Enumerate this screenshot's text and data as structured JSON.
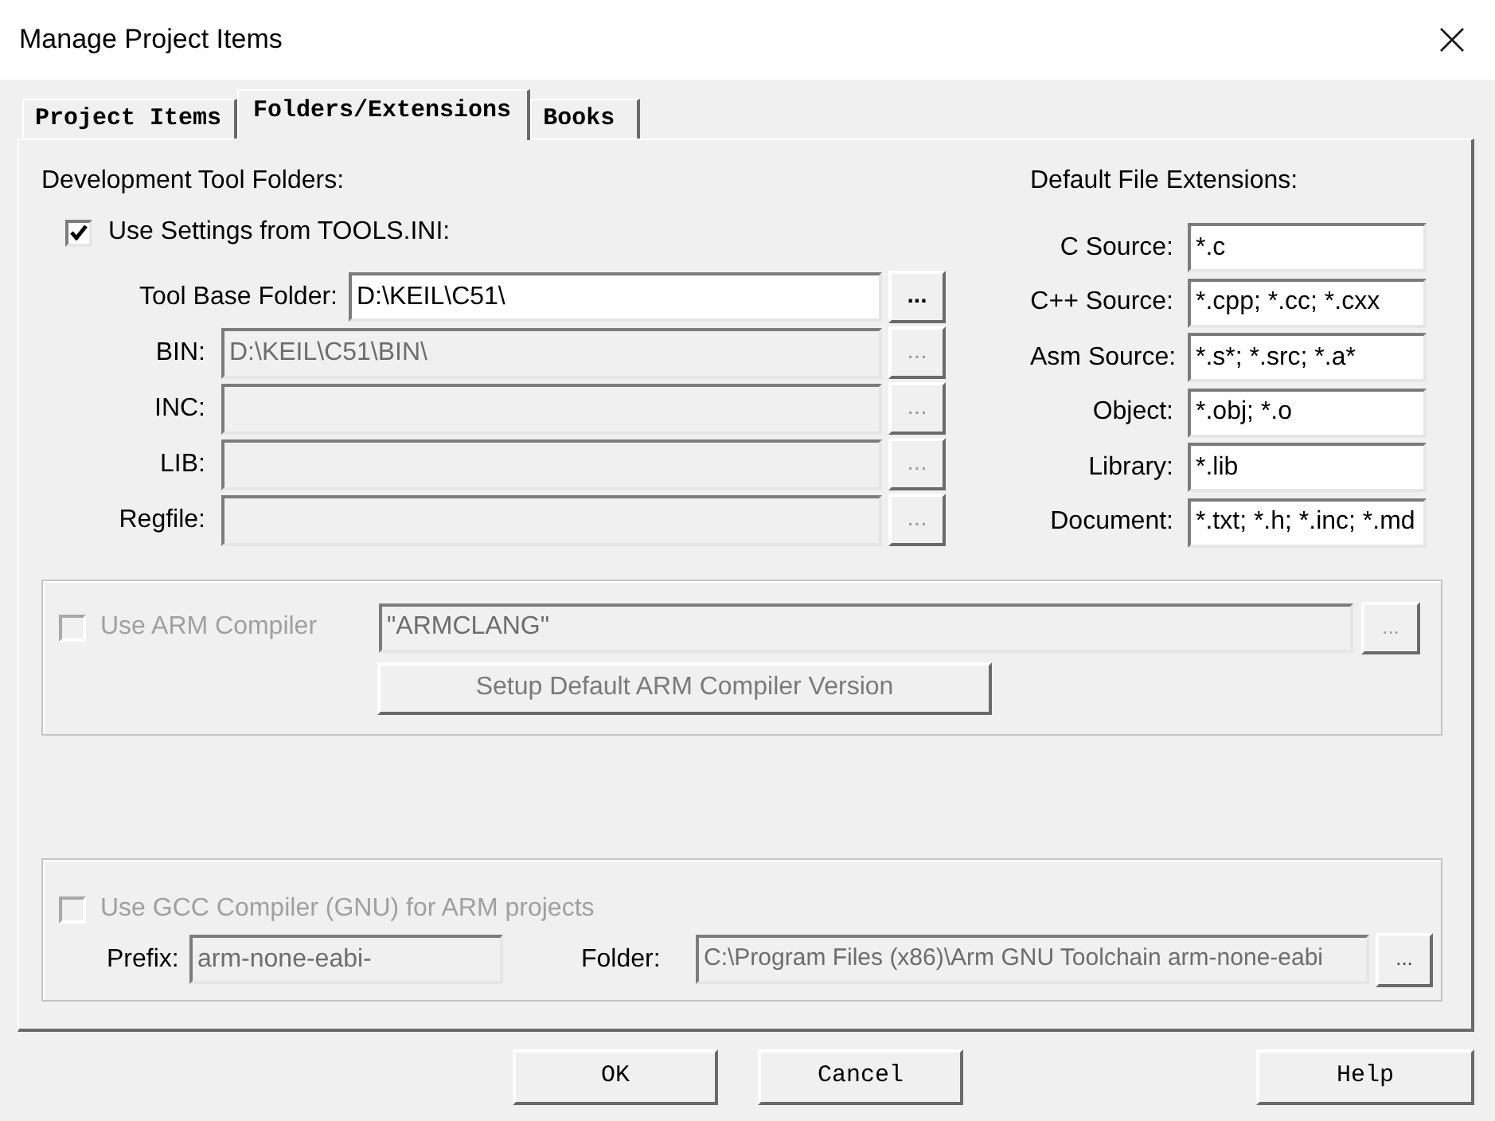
{
  "window": {
    "title": "Manage Project Items"
  },
  "tabs": [
    {
      "label": "Project Items",
      "selected": false
    },
    {
      "label": "Folders/Extensions",
      "selected": true
    },
    {
      "label": "Books",
      "selected": false
    }
  ],
  "tool_folders": {
    "heading": "Development Tool Folders:",
    "use_tools_ini": {
      "label": "Use Settings from TOOLS.INI:",
      "checked": true
    },
    "fields": [
      {
        "label": "Tool Base Folder:",
        "value": "D:\\KEIL\\C51\\",
        "disabled": false,
        "browse": "..."
      },
      {
        "label": "BIN:",
        "value": "D:\\KEIL\\C51\\BIN\\",
        "disabled": true,
        "browse": "..."
      },
      {
        "label": "INC:",
        "disabled": true,
        "browse": "..."
      },
      {
        "label": "LIB:",
        "disabled": true,
        "browse": "..."
      },
      {
        "label": "Regfile:",
        "disabled": true,
        "browse": "..."
      }
    ]
  },
  "file_extensions": {
    "heading": "Default File Extensions:",
    "fields": [
      {
        "label": "C Source:",
        "value": "*.c"
      },
      {
        "label": "C++ Source:",
        "value": "*.cpp; *.cc; *.cxx"
      },
      {
        "label": "Asm Source:",
        "value": "*.s*; *.src; *.a*"
      },
      {
        "label": "Object:",
        "value": "*.obj; *.o"
      },
      {
        "label": "Library:",
        "value": "*.lib"
      },
      {
        "label": "Document:",
        "value": "*.txt; *.h; *.inc; *.md"
      }
    ]
  },
  "arm_compiler": {
    "label": "Use ARM Compiler",
    "checked": false,
    "disabled": true,
    "compiler": "\"ARMCLANG\"",
    "browse": "...",
    "setup_button": "Setup Default ARM Compiler Version"
  },
  "gcc_compiler": {
    "label": "Use GCC Compiler (GNU) for ARM projects",
    "checked": false,
    "disabled": true,
    "prefix": {
      "label": "Prefix:",
      "value": "arm-none-eabi-"
    },
    "folder": {
      "label": "Folder:",
      "value": "C:\\Program Files (x86)\\Arm GNU Toolchain arm-none-eabi"
    },
    "browse": "..."
  },
  "buttons": [
    {
      "label": "OK"
    },
    {
      "label": "Cancel"
    },
    {
      "label": "Help"
    }
  ]
}
